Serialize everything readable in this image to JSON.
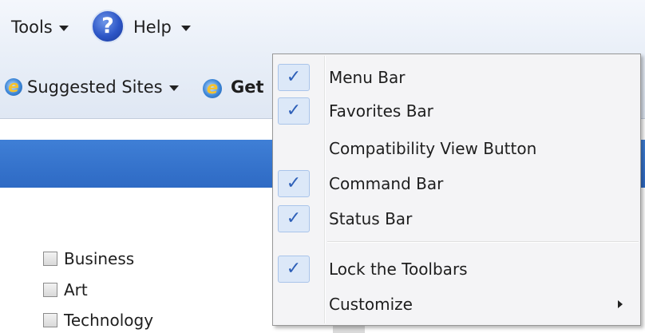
{
  "toolbar": {
    "tools_label": "Tools",
    "help_label": "Help",
    "help_icon_glyph": "?"
  },
  "favorites_bar": {
    "suggested_sites_label": "Suggested Sites",
    "get_label": "Get"
  },
  "checkbox_list": [
    {
      "label": "Business",
      "checked": false
    },
    {
      "label": "Art",
      "checked": false
    },
    {
      "label": "Technology",
      "checked": false
    }
  ],
  "menu": {
    "items": [
      {
        "label": "Menu Bar",
        "checked": true
      },
      {
        "label": "Favorites Bar",
        "checked": true
      },
      {
        "label": "Compatibility View Button",
        "checked": false
      },
      {
        "label": "Command Bar",
        "checked": true
      },
      {
        "label": "Status Bar",
        "checked": true
      },
      {
        "label": "Lock the Toolbars",
        "checked": true
      },
      {
        "label": "Customize",
        "checked": false,
        "has_submenu": true
      }
    ],
    "check_glyph": "✓"
  },
  "colors": {
    "accent_blue": "#2e6ac4",
    "check_blue": "#2d5fb8",
    "menu_bg": "#f4f4f6"
  }
}
